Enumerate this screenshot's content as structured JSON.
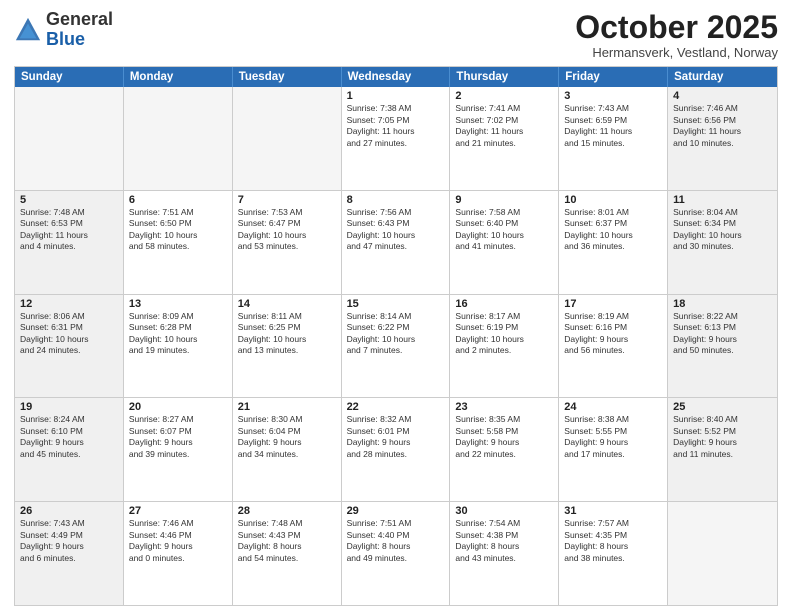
{
  "header": {
    "logo_general": "General",
    "logo_blue": "Blue",
    "month_title": "October 2025",
    "location": "Hermansverk, Vestland, Norway"
  },
  "days_of_week": [
    "Sunday",
    "Monday",
    "Tuesday",
    "Wednesday",
    "Thursday",
    "Friday",
    "Saturday"
  ],
  "rows": [
    [
      {
        "day": "",
        "text": "",
        "empty": true
      },
      {
        "day": "",
        "text": "",
        "empty": true
      },
      {
        "day": "",
        "text": "",
        "empty": true
      },
      {
        "day": "1",
        "text": "Sunrise: 7:38 AM\nSunset: 7:05 PM\nDaylight: 11 hours\nand 27 minutes.",
        "empty": false
      },
      {
        "day": "2",
        "text": "Sunrise: 7:41 AM\nSunset: 7:02 PM\nDaylight: 11 hours\nand 21 minutes.",
        "empty": false
      },
      {
        "day": "3",
        "text": "Sunrise: 7:43 AM\nSunset: 6:59 PM\nDaylight: 11 hours\nand 15 minutes.",
        "empty": false
      },
      {
        "day": "4",
        "text": "Sunrise: 7:46 AM\nSunset: 6:56 PM\nDaylight: 11 hours\nand 10 minutes.",
        "empty": false,
        "shaded": true
      }
    ],
    [
      {
        "day": "5",
        "text": "Sunrise: 7:48 AM\nSunset: 6:53 PM\nDaylight: 11 hours\nand 4 minutes.",
        "empty": false,
        "shaded": true
      },
      {
        "day": "6",
        "text": "Sunrise: 7:51 AM\nSunset: 6:50 PM\nDaylight: 10 hours\nand 58 minutes.",
        "empty": false
      },
      {
        "day": "7",
        "text": "Sunrise: 7:53 AM\nSunset: 6:47 PM\nDaylight: 10 hours\nand 53 minutes.",
        "empty": false
      },
      {
        "day": "8",
        "text": "Sunrise: 7:56 AM\nSunset: 6:43 PM\nDaylight: 10 hours\nand 47 minutes.",
        "empty": false
      },
      {
        "day": "9",
        "text": "Sunrise: 7:58 AM\nSunset: 6:40 PM\nDaylight: 10 hours\nand 41 minutes.",
        "empty": false
      },
      {
        "day": "10",
        "text": "Sunrise: 8:01 AM\nSunset: 6:37 PM\nDaylight: 10 hours\nand 36 minutes.",
        "empty": false
      },
      {
        "day": "11",
        "text": "Sunrise: 8:04 AM\nSunset: 6:34 PM\nDaylight: 10 hours\nand 30 minutes.",
        "empty": false,
        "shaded": true
      }
    ],
    [
      {
        "day": "12",
        "text": "Sunrise: 8:06 AM\nSunset: 6:31 PM\nDaylight: 10 hours\nand 24 minutes.",
        "empty": false,
        "shaded": true
      },
      {
        "day": "13",
        "text": "Sunrise: 8:09 AM\nSunset: 6:28 PM\nDaylight: 10 hours\nand 19 minutes.",
        "empty": false
      },
      {
        "day": "14",
        "text": "Sunrise: 8:11 AM\nSunset: 6:25 PM\nDaylight: 10 hours\nand 13 minutes.",
        "empty": false
      },
      {
        "day": "15",
        "text": "Sunrise: 8:14 AM\nSunset: 6:22 PM\nDaylight: 10 hours\nand 7 minutes.",
        "empty": false
      },
      {
        "day": "16",
        "text": "Sunrise: 8:17 AM\nSunset: 6:19 PM\nDaylight: 10 hours\nand 2 minutes.",
        "empty": false
      },
      {
        "day": "17",
        "text": "Sunrise: 8:19 AM\nSunset: 6:16 PM\nDaylight: 9 hours\nand 56 minutes.",
        "empty": false
      },
      {
        "day": "18",
        "text": "Sunrise: 8:22 AM\nSunset: 6:13 PM\nDaylight: 9 hours\nand 50 minutes.",
        "empty": false,
        "shaded": true
      }
    ],
    [
      {
        "day": "19",
        "text": "Sunrise: 8:24 AM\nSunset: 6:10 PM\nDaylight: 9 hours\nand 45 minutes.",
        "empty": false,
        "shaded": true
      },
      {
        "day": "20",
        "text": "Sunrise: 8:27 AM\nSunset: 6:07 PM\nDaylight: 9 hours\nand 39 minutes.",
        "empty": false
      },
      {
        "day": "21",
        "text": "Sunrise: 8:30 AM\nSunset: 6:04 PM\nDaylight: 9 hours\nand 34 minutes.",
        "empty": false
      },
      {
        "day": "22",
        "text": "Sunrise: 8:32 AM\nSunset: 6:01 PM\nDaylight: 9 hours\nand 28 minutes.",
        "empty": false
      },
      {
        "day": "23",
        "text": "Sunrise: 8:35 AM\nSunset: 5:58 PM\nDaylight: 9 hours\nand 22 minutes.",
        "empty": false
      },
      {
        "day": "24",
        "text": "Sunrise: 8:38 AM\nSunset: 5:55 PM\nDaylight: 9 hours\nand 17 minutes.",
        "empty": false
      },
      {
        "day": "25",
        "text": "Sunrise: 8:40 AM\nSunset: 5:52 PM\nDaylight: 9 hours\nand 11 minutes.",
        "empty": false,
        "shaded": true
      }
    ],
    [
      {
        "day": "26",
        "text": "Sunrise: 7:43 AM\nSunset: 4:49 PM\nDaylight: 9 hours\nand 6 minutes.",
        "empty": false,
        "shaded": true
      },
      {
        "day": "27",
        "text": "Sunrise: 7:46 AM\nSunset: 4:46 PM\nDaylight: 9 hours\nand 0 minutes.",
        "empty": false
      },
      {
        "day": "28",
        "text": "Sunrise: 7:48 AM\nSunset: 4:43 PM\nDaylight: 8 hours\nand 54 minutes.",
        "empty": false
      },
      {
        "day": "29",
        "text": "Sunrise: 7:51 AM\nSunset: 4:40 PM\nDaylight: 8 hours\nand 49 minutes.",
        "empty": false
      },
      {
        "day": "30",
        "text": "Sunrise: 7:54 AM\nSunset: 4:38 PM\nDaylight: 8 hours\nand 43 minutes.",
        "empty": false
      },
      {
        "day": "31",
        "text": "Sunrise: 7:57 AM\nSunset: 4:35 PM\nDaylight: 8 hours\nand 38 minutes.",
        "empty": false
      },
      {
        "day": "",
        "text": "",
        "empty": true,
        "shaded": true
      }
    ]
  ]
}
